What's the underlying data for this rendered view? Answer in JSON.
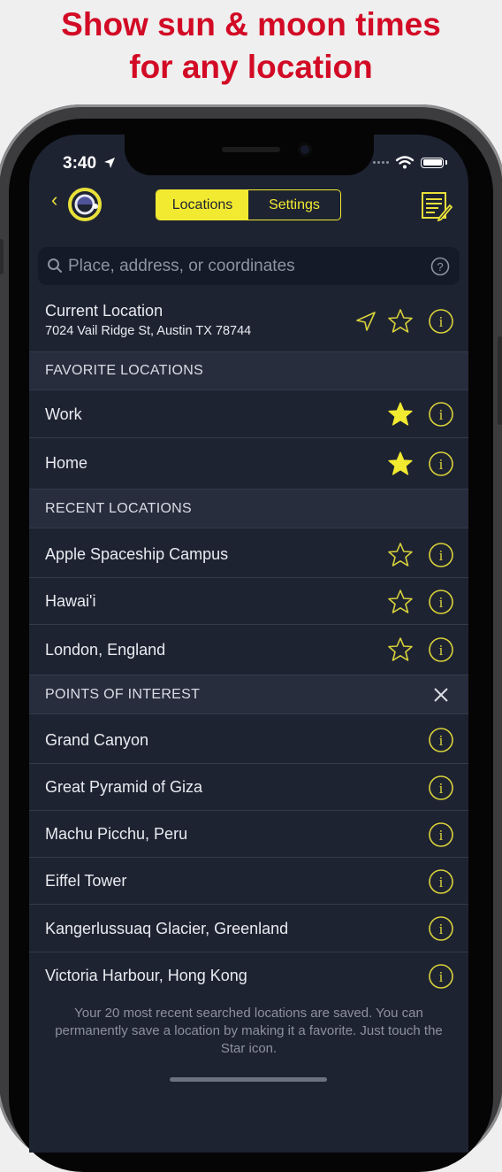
{
  "headline": {
    "line1": "Show sun & moon times",
    "line2": "for any location"
  },
  "status_bar": {
    "time": "3:40"
  },
  "nav": {
    "tabs": [
      {
        "label": "Locations",
        "active": true
      },
      {
        "label": "Settings",
        "active": false
      }
    ]
  },
  "search": {
    "placeholder": "Place, address, or coordinates"
  },
  "current_location": {
    "title": "Current Location",
    "address": "7024 Vail Ridge St, Austin TX 78744"
  },
  "sections": {
    "favorites": "FAVORITE LOCATIONS",
    "recent": "RECENT LOCATIONS",
    "poi": "POINTS OF INTEREST"
  },
  "favorites": [
    {
      "label": "Work"
    },
    {
      "label": "Home"
    }
  ],
  "recent": [
    {
      "label": "Apple Spaceship Campus"
    },
    {
      "label": "Hawai'i"
    },
    {
      "label": "London, England"
    }
  ],
  "poi": [
    {
      "label": "Grand Canyon"
    },
    {
      "label": "Great Pyramid of Giza"
    },
    {
      "label": "Machu Picchu, Peru"
    },
    {
      "label": "Eiffel Tower"
    },
    {
      "label": "Kangerlussuaq Glacier, Greenland"
    },
    {
      "label": "Victoria Harbour, Hong Kong"
    }
  ],
  "footer_note": "Your 20 most recent searched locations are saved. You can permanently save a location by making it a favorite. Just touch the Star icon.",
  "colors": {
    "accent": "#f2ea30",
    "headline": "#d20a25",
    "background": "#1e2332"
  }
}
